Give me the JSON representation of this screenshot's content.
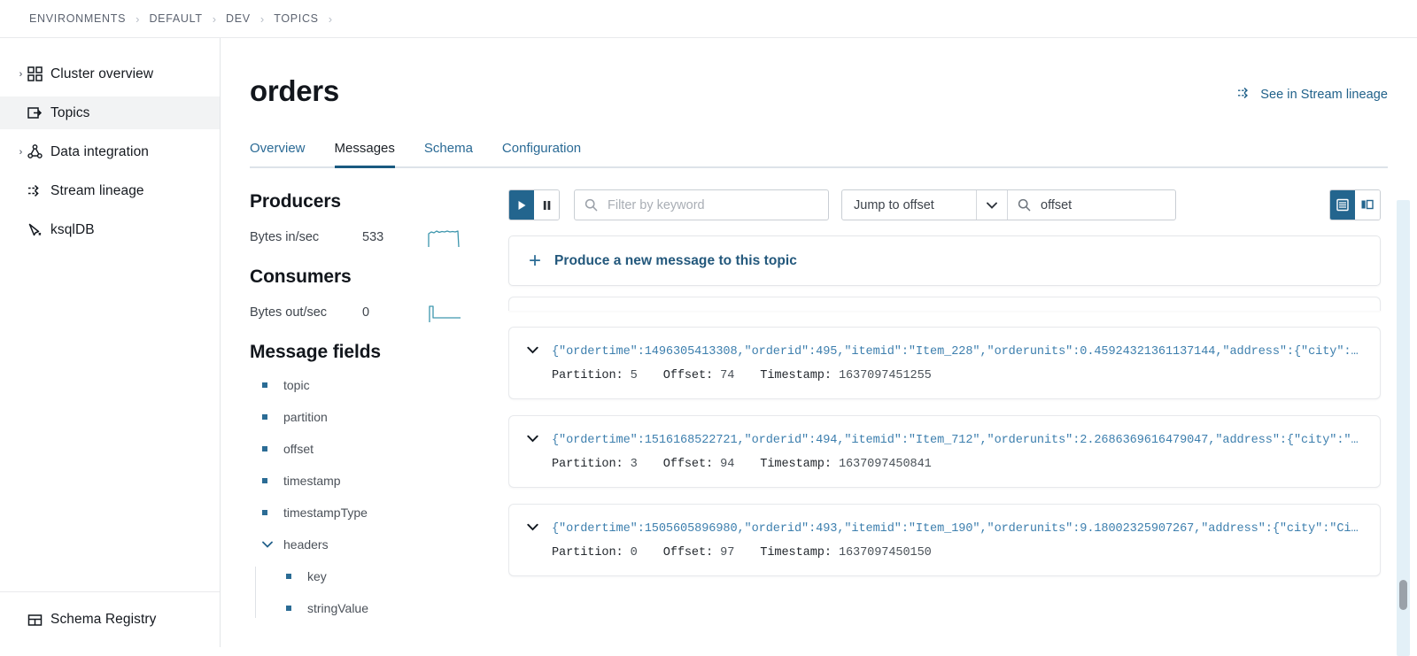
{
  "breadcrumb": {
    "items": [
      "ENVIRONMENTS",
      "DEFAULT",
      "DEV",
      "TOPICS"
    ],
    "separator": "›"
  },
  "sidebar": {
    "items": [
      {
        "label": "Cluster overview",
        "icon": "grid-icon",
        "expandable": true,
        "active": false
      },
      {
        "label": "Topics",
        "icon": "topic-icon",
        "expandable": false,
        "active": true
      },
      {
        "label": "Data integration",
        "icon": "connector-icon",
        "expandable": true,
        "active": false
      },
      {
        "label": "Stream lineage",
        "icon": "lineage-icon",
        "expandable": false,
        "active": false
      },
      {
        "label": "ksqlDB",
        "icon": "ksqldb-icon",
        "expandable": false,
        "active": false
      }
    ],
    "footer": {
      "label": "Schema Registry",
      "icon": "schema-registry-icon"
    }
  },
  "header": {
    "title": "orders",
    "lineage_link": "See in Stream lineage"
  },
  "tabs": [
    {
      "label": "Overview",
      "active": false
    },
    {
      "label": "Messages",
      "active": true
    },
    {
      "label": "Schema",
      "active": false
    },
    {
      "label": "Configuration",
      "active": false
    }
  ],
  "metrics": {
    "producers_title": "Producers",
    "producers_label": "Bytes in/sec",
    "producers_value": "533",
    "consumers_title": "Consumers",
    "consumers_label": "Bytes out/sec",
    "consumers_value": "0"
  },
  "message_fields": {
    "title": "Message fields",
    "items": [
      {
        "name": "topic",
        "type": "leaf"
      },
      {
        "name": "partition",
        "type": "leaf"
      },
      {
        "name": "offset",
        "type": "leaf"
      },
      {
        "name": "timestamp",
        "type": "leaf"
      },
      {
        "name": "timestampType",
        "type": "leaf"
      },
      {
        "name": "headers",
        "type": "group",
        "expanded": true,
        "children": [
          {
            "name": "key",
            "type": "leaf"
          },
          {
            "name": "stringValue",
            "type": "leaf"
          }
        ]
      }
    ]
  },
  "toolbar": {
    "play_icon": "play-icon",
    "pause_icon": "pause-icon",
    "filter_placeholder": "Filter by keyword",
    "filter_value": "",
    "jump_selected": "Jump to offset",
    "offset_value": "offset",
    "offset_placeholder": "offset",
    "view_list_icon": "list-view-icon",
    "view_split_icon": "split-view-icon"
  },
  "produce": {
    "label": "Produce a new message to this topic",
    "plus": "+"
  },
  "messages": {
    "meta_labels": {
      "partition": "Partition:",
      "offset": "Offset:",
      "timestamp": "Timestamp:"
    },
    "rows": [
      {
        "json": "{\"ordertime\":1496305413308,\"orderid\":495,\"itemid\":\"Item_228\",\"orderunits\":0.45924321361137144,\"address\":{\"city\":\"…",
        "partition": "5",
        "offset": "74",
        "timestamp": "1637097451255"
      },
      {
        "json": "{\"ordertime\":1516168522721,\"orderid\":494,\"itemid\":\"Item_712\",\"orderunits\":2.2686369616479047,\"address\":{\"city\":\"C…",
        "partition": "3",
        "offset": "94",
        "timestamp": "1637097450841"
      },
      {
        "json": "{\"ordertime\":1505605896980,\"orderid\":493,\"itemid\":\"Item_190\",\"orderunits\":9.18002325907267,\"address\":{\"city\":\"Cit…",
        "partition": "0",
        "offset": "97",
        "timestamp": "1637097450150"
      }
    ]
  },
  "colors": {
    "accent": "#23658e",
    "link": "#20618a",
    "spark": "#3d96ad",
    "active_tab_underline": "#1a5a80",
    "scrollbar_track": "#e3f0f7",
    "scrollbar_thumb": "#9aa1a9"
  }
}
